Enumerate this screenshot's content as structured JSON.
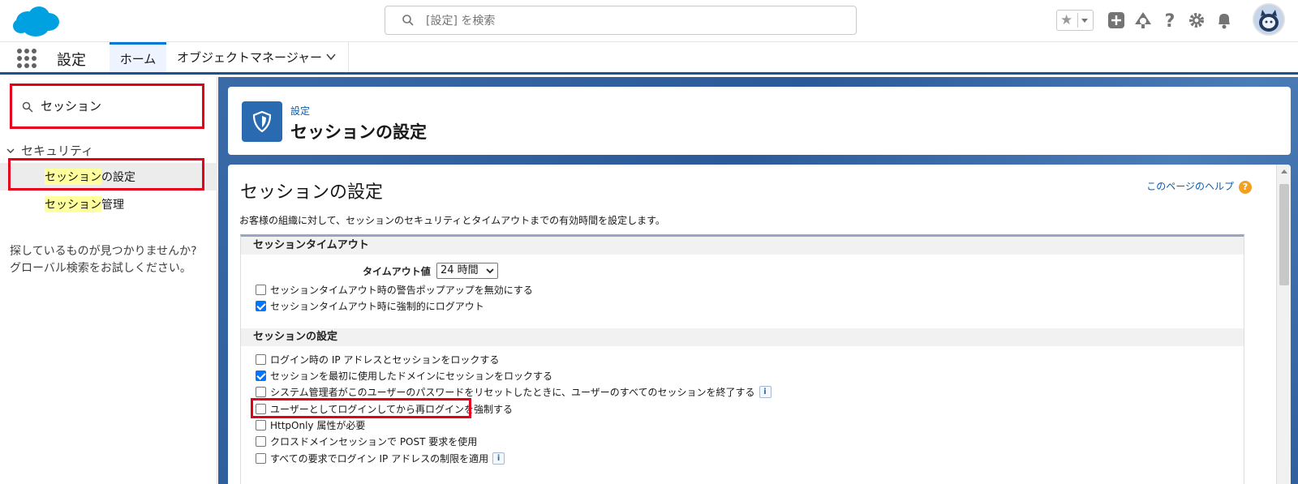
{
  "header": {
    "search_placeholder": "[設定] を検索",
    "icons": [
      "salesforce-logo",
      "favorites-star-icon",
      "favorites-dropdown-icon",
      "add-icon",
      "trailhead-icon",
      "help-icon",
      "gear-icon",
      "bell-icon",
      "avatar"
    ]
  },
  "navbar": {
    "app_name": "設定",
    "tabs": [
      {
        "label": "ホーム",
        "active": true
      },
      {
        "label": "オブジェクトマネージャー",
        "active": false
      }
    ]
  },
  "sidebar": {
    "quickfind_value": "セッション",
    "section": "セキュリティ",
    "items": [
      {
        "highlight": "セッション",
        "rest": "の設定",
        "selected": true
      },
      {
        "highlight": "セッション",
        "rest": "管理",
        "selected": false
      }
    ],
    "not_found_line1": "探しているものが見つかりませんか?",
    "not_found_line2": "グローバル検索をお試しください。"
  },
  "page_header": {
    "breadcrumb": "設定",
    "title": "セッションの設定"
  },
  "content": {
    "title": "セッションの設定",
    "help_link": "このページのヘルプ",
    "help_icon": "?",
    "description": "お客様の組織に対して、セッションのセキュリティとタイムアウトまでの有効時間を設定します。",
    "timeout_section": {
      "heading": "セッションタイムアウト",
      "timeout_label": "タイムアウト値",
      "timeout_value": "24 時間",
      "options": [
        {
          "label": "セッションタイムアウト時の警告ポップアップを無効にする",
          "checked": false
        },
        {
          "label": "セッションタイムアウト時に強制的にログアウト",
          "checked": true
        }
      ]
    },
    "session_section": {
      "heading": "セッションの設定",
      "options": [
        {
          "label": "ログイン時の IP アドレスとセッションをロックする",
          "checked": false,
          "info": false
        },
        {
          "label": "セッションを最初に使用したドメインにセッションをロックする",
          "checked": true,
          "info": false
        },
        {
          "label": "システム管理者がこのユーザーのパスワードをリセットしたときに、ユーザーのすべてのセッションを終了する",
          "checked": false,
          "info": true
        },
        {
          "label": "ユーザーとしてログインしてから再ログインを強制する",
          "checked": false,
          "info": false,
          "highlighted": true
        },
        {
          "label": "HttpOnly 属性が必要",
          "checked": false,
          "info": false
        },
        {
          "label": "クロスドメインセッションで POST 要求を使用",
          "checked": false,
          "info": false
        },
        {
          "label": "すべての要求でログイン IP アドレスの制限を適用",
          "checked": false,
          "info": true
        }
      ]
    },
    "info_glyph": "i"
  },
  "colors": {
    "accent": "#0176d3",
    "annotation_red": "#e3001b",
    "highlight_yellow": "#ffff9e",
    "page_blue": "#2c5a99"
  }
}
